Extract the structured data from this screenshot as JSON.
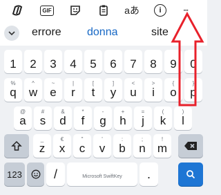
{
  "toolbar": {
    "items": [
      {
        "icon": "copilot-icon",
        "label": ""
      },
      {
        "icon": "gif-icon",
        "label": "GIF"
      },
      {
        "icon": "sticker-icon",
        "label": ""
      },
      {
        "icon": "clipboard-icon",
        "label": ""
      },
      {
        "icon": "translate-icon",
        "label": "aあ"
      },
      {
        "icon": "info-icon",
        "label": "i"
      },
      {
        "icon": "more-icon",
        "label": "···"
      }
    ]
  },
  "suggestions": {
    "words": [
      "errore",
      "donna",
      "site"
    ]
  },
  "keyboard": {
    "row1": [
      {
        "hint": "",
        "key": "1"
      },
      {
        "hint": "",
        "key": "2"
      },
      {
        "hint": "",
        "key": "3"
      },
      {
        "hint": "",
        "key": "4"
      },
      {
        "hint": "",
        "key": "5"
      },
      {
        "hint": "",
        "key": "6"
      },
      {
        "hint": "",
        "key": "7"
      },
      {
        "hint": "",
        "key": "8"
      },
      {
        "hint": "",
        "key": "9"
      },
      {
        "hint": "",
        "key": "0"
      }
    ],
    "row2": [
      {
        "hint": "%",
        "key": "q"
      },
      {
        "hint": "^",
        "key": "w"
      },
      {
        "hint": "~",
        "key": "e"
      },
      {
        "hint": "|",
        "key": "r"
      },
      {
        "hint": "[",
        "key": "t"
      },
      {
        "hint": "]",
        "key": "y"
      },
      {
        "hint": "<",
        "key": "u"
      },
      {
        "hint": ">",
        "key": "i"
      },
      {
        "hint": "{",
        "key": "o"
      },
      {
        "hint": "}",
        "key": "p"
      }
    ],
    "row3": [
      {
        "hint": "@",
        "key": "a"
      },
      {
        "hint": "#",
        "key": "s"
      },
      {
        "hint": "&",
        "key": "d"
      },
      {
        "hint": "*",
        "key": "f"
      },
      {
        "hint": "-",
        "key": "g"
      },
      {
        "hint": "+",
        "key": "h"
      },
      {
        "hint": "=",
        "key": "j"
      },
      {
        "hint": "(",
        "key": "k"
      },
      {
        "hint": ")",
        "key": "l"
      }
    ],
    "row4": [
      {
        "hint": "_",
        "key": "z"
      },
      {
        "hint": "€",
        "key": "x"
      },
      {
        "hint": "\"",
        "key": "c"
      },
      {
        "hint": "'",
        "key": "v"
      },
      {
        "hint": ":",
        "key": "b"
      },
      {
        "hint": ";",
        "key": "n"
      },
      {
        "hint": "!",
        "key": "m"
      }
    ],
    "shift_icon": "shift-icon",
    "backspace_icon": "backspace-icon",
    "numbers_label": "123",
    "emoji_icon": "emoji-icon",
    "slash_label": "/",
    "space_label": "Microsoft SwiftKey",
    "period_label": ".",
    "search_icon": "search-icon"
  },
  "annotation": {
    "color": "#e8212b",
    "shape": "up-arrow"
  }
}
